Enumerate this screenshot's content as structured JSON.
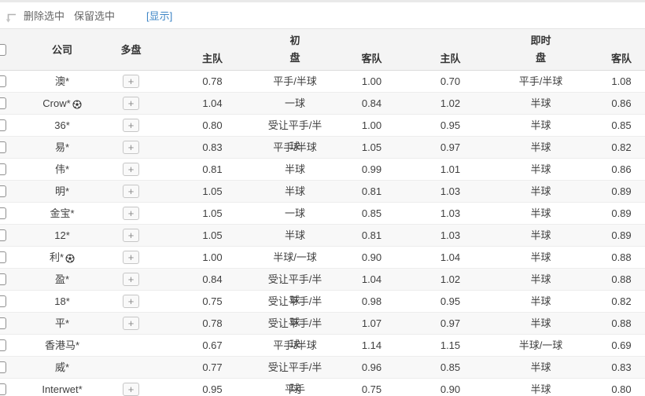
{
  "toolbar": {
    "delete_selected_label": "删除选中",
    "keep_selected_label": "保留选中",
    "show_label": "[显示]"
  },
  "table": {
    "plus_label": "+",
    "headers": {
      "company": "公司",
      "multi": "多盘",
      "initial_group": "初",
      "live_group": "即时",
      "pan": "盘",
      "home": "主队",
      "away": "客队"
    },
    "rows": [
      {
        "company": "澳*",
        "ball": false,
        "multi": true,
        "i_home": "0.78",
        "i_pan": "平手/半球",
        "i_away": "1.00",
        "l_home": "0.70",
        "l_pan": "平手/半球",
        "l_away": "1.08"
      },
      {
        "company": "Crow*",
        "ball": true,
        "multi": true,
        "i_home": "1.04",
        "i_pan": "一球",
        "i_away": "0.84",
        "l_home": "1.02",
        "l_pan": "半球",
        "l_away": "0.86"
      },
      {
        "company": "36*",
        "ball": false,
        "multi": true,
        "i_home": "0.80",
        "i_pan": "受让平手/半球",
        "i_away": "1.00",
        "l_home": "0.95",
        "l_pan": "半球",
        "l_away": "0.85"
      },
      {
        "company": "易*",
        "ball": false,
        "multi": true,
        "i_home": "0.83",
        "i_pan": "平手/半球",
        "i_away": "1.05",
        "l_home": "0.97",
        "l_pan": "半球",
        "l_away": "0.82"
      },
      {
        "company": "伟*",
        "ball": false,
        "multi": true,
        "i_home": "0.81",
        "i_pan": "半球",
        "i_away": "0.99",
        "l_home": "1.01",
        "l_pan": "半球",
        "l_away": "0.86"
      },
      {
        "company": "明*",
        "ball": false,
        "multi": true,
        "i_home": "1.05",
        "i_pan": "半球",
        "i_away": "0.81",
        "l_home": "1.03",
        "l_pan": "半球",
        "l_away": "0.89"
      },
      {
        "company": "金宝*",
        "ball": false,
        "multi": true,
        "i_home": "1.05",
        "i_pan": "一球",
        "i_away": "0.85",
        "l_home": "1.03",
        "l_pan": "半球",
        "l_away": "0.89"
      },
      {
        "company": "12*",
        "ball": false,
        "multi": true,
        "i_home": "1.05",
        "i_pan": "半球",
        "i_away": "0.81",
        "l_home": "1.03",
        "l_pan": "半球",
        "l_away": "0.89"
      },
      {
        "company": "利*",
        "ball": true,
        "multi": true,
        "i_home": "1.00",
        "i_pan": "半球/一球",
        "i_away": "0.90",
        "l_home": "1.04",
        "l_pan": "半球",
        "l_away": "0.88"
      },
      {
        "company": "盈*",
        "ball": false,
        "multi": true,
        "i_home": "0.84",
        "i_pan": "受让平手/半球",
        "i_away": "1.04",
        "l_home": "1.02",
        "l_pan": "半球",
        "l_away": "0.88"
      },
      {
        "company": "18*",
        "ball": false,
        "multi": true,
        "i_home": "0.75",
        "i_pan": "受让平手/半球",
        "i_away": "0.98",
        "l_home": "0.95",
        "l_pan": "半球",
        "l_away": "0.82"
      },
      {
        "company": "平*",
        "ball": false,
        "multi": true,
        "i_home": "0.78",
        "i_pan": "受让平手/半球",
        "i_away": "1.07",
        "l_home": "0.97",
        "l_pan": "半球",
        "l_away": "0.88"
      },
      {
        "company": "香港马*",
        "ball": false,
        "multi": false,
        "i_home": "0.67",
        "i_pan": "平手/半球",
        "i_away": "1.14",
        "l_home": "1.15",
        "l_pan": "半球/一球",
        "l_away": "0.69"
      },
      {
        "company": "威*",
        "ball": false,
        "multi": false,
        "i_home": "0.77",
        "i_pan": "受让平手/半球",
        "i_away": "0.96",
        "l_home": "0.85",
        "l_pan": "半球",
        "l_away": "0.83"
      },
      {
        "company": "Interwet*",
        "ball": false,
        "multi": true,
        "i_home": "0.95",
        "i_pan": "平手",
        "i_away": "0.75",
        "l_home": "0.90",
        "l_pan": "半球",
        "l_away": "0.80"
      }
    ]
  },
  "colors": {
    "link_blue": "#3d85c6",
    "header_bg": "#f4f4f4",
    "alt_row_bg": "#f8f8f8",
    "text": "#404040"
  }
}
